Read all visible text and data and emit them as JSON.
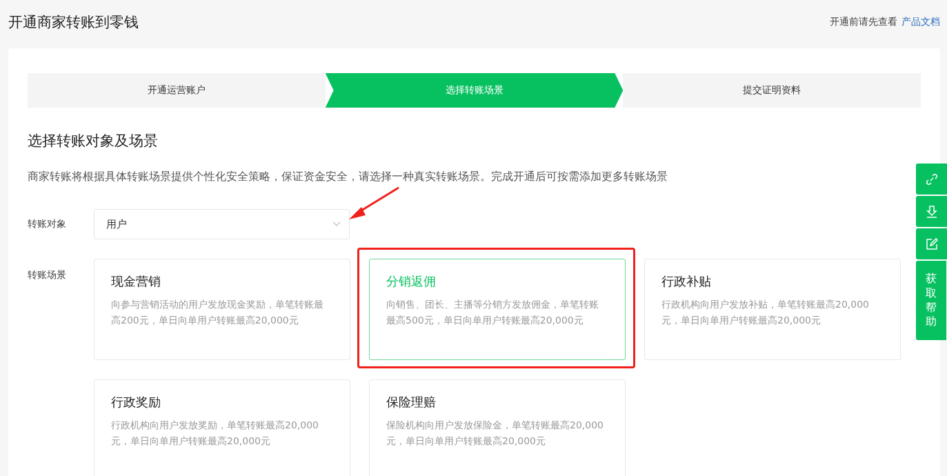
{
  "header": {
    "title": "开通商家转账到零钱",
    "doc_hint": "开通前请先查看",
    "doc_link": "产品文档"
  },
  "steps": [
    {
      "label": "开通运营账户",
      "selected": false
    },
    {
      "label": "选择转账场景",
      "selected": true
    },
    {
      "label": "提交证明资料",
      "selected": false
    }
  ],
  "section": {
    "title": "选择转账对象及场景",
    "description": "商家转账将根据具体转账场景提供个性化安全策略，保证资金安全，请选择一种真实转账场景。完成开通后可按需添加更多转账场景"
  },
  "target": {
    "label": "转账对象",
    "value": "用户"
  },
  "scenes": {
    "label": "转账场景",
    "items": [
      {
        "title": "现金营销",
        "description": "向参与营销活动的用户发放现金奖励，单笔转账最高200元，单日向单用户转账最高20,000元",
        "selected": false
      },
      {
        "title": "分销返佣",
        "description": "向销售、团长、主播等分销方发放佣金，单笔转账最高500元，单日向单用户转账最高20,000元",
        "selected": true
      },
      {
        "title": "行政补贴",
        "description": "行政机构向用户发放补贴，单笔转账最高20,000元，单日向单用户转账最高20,000元",
        "selected": false
      },
      {
        "title": "行政奖励",
        "description": "行政机构向用户发放奖励，单笔转账最高20,000元，单日向单用户转账最高20,000元",
        "selected": false
      },
      {
        "title": "保险理赔",
        "description": "保险机构向用户发放保险金，单笔转账最高20,000元，单日向单用户转账最高20,000元",
        "selected": false
      }
    ]
  },
  "side_toolbar": {
    "help_label": "获取帮助"
  }
}
